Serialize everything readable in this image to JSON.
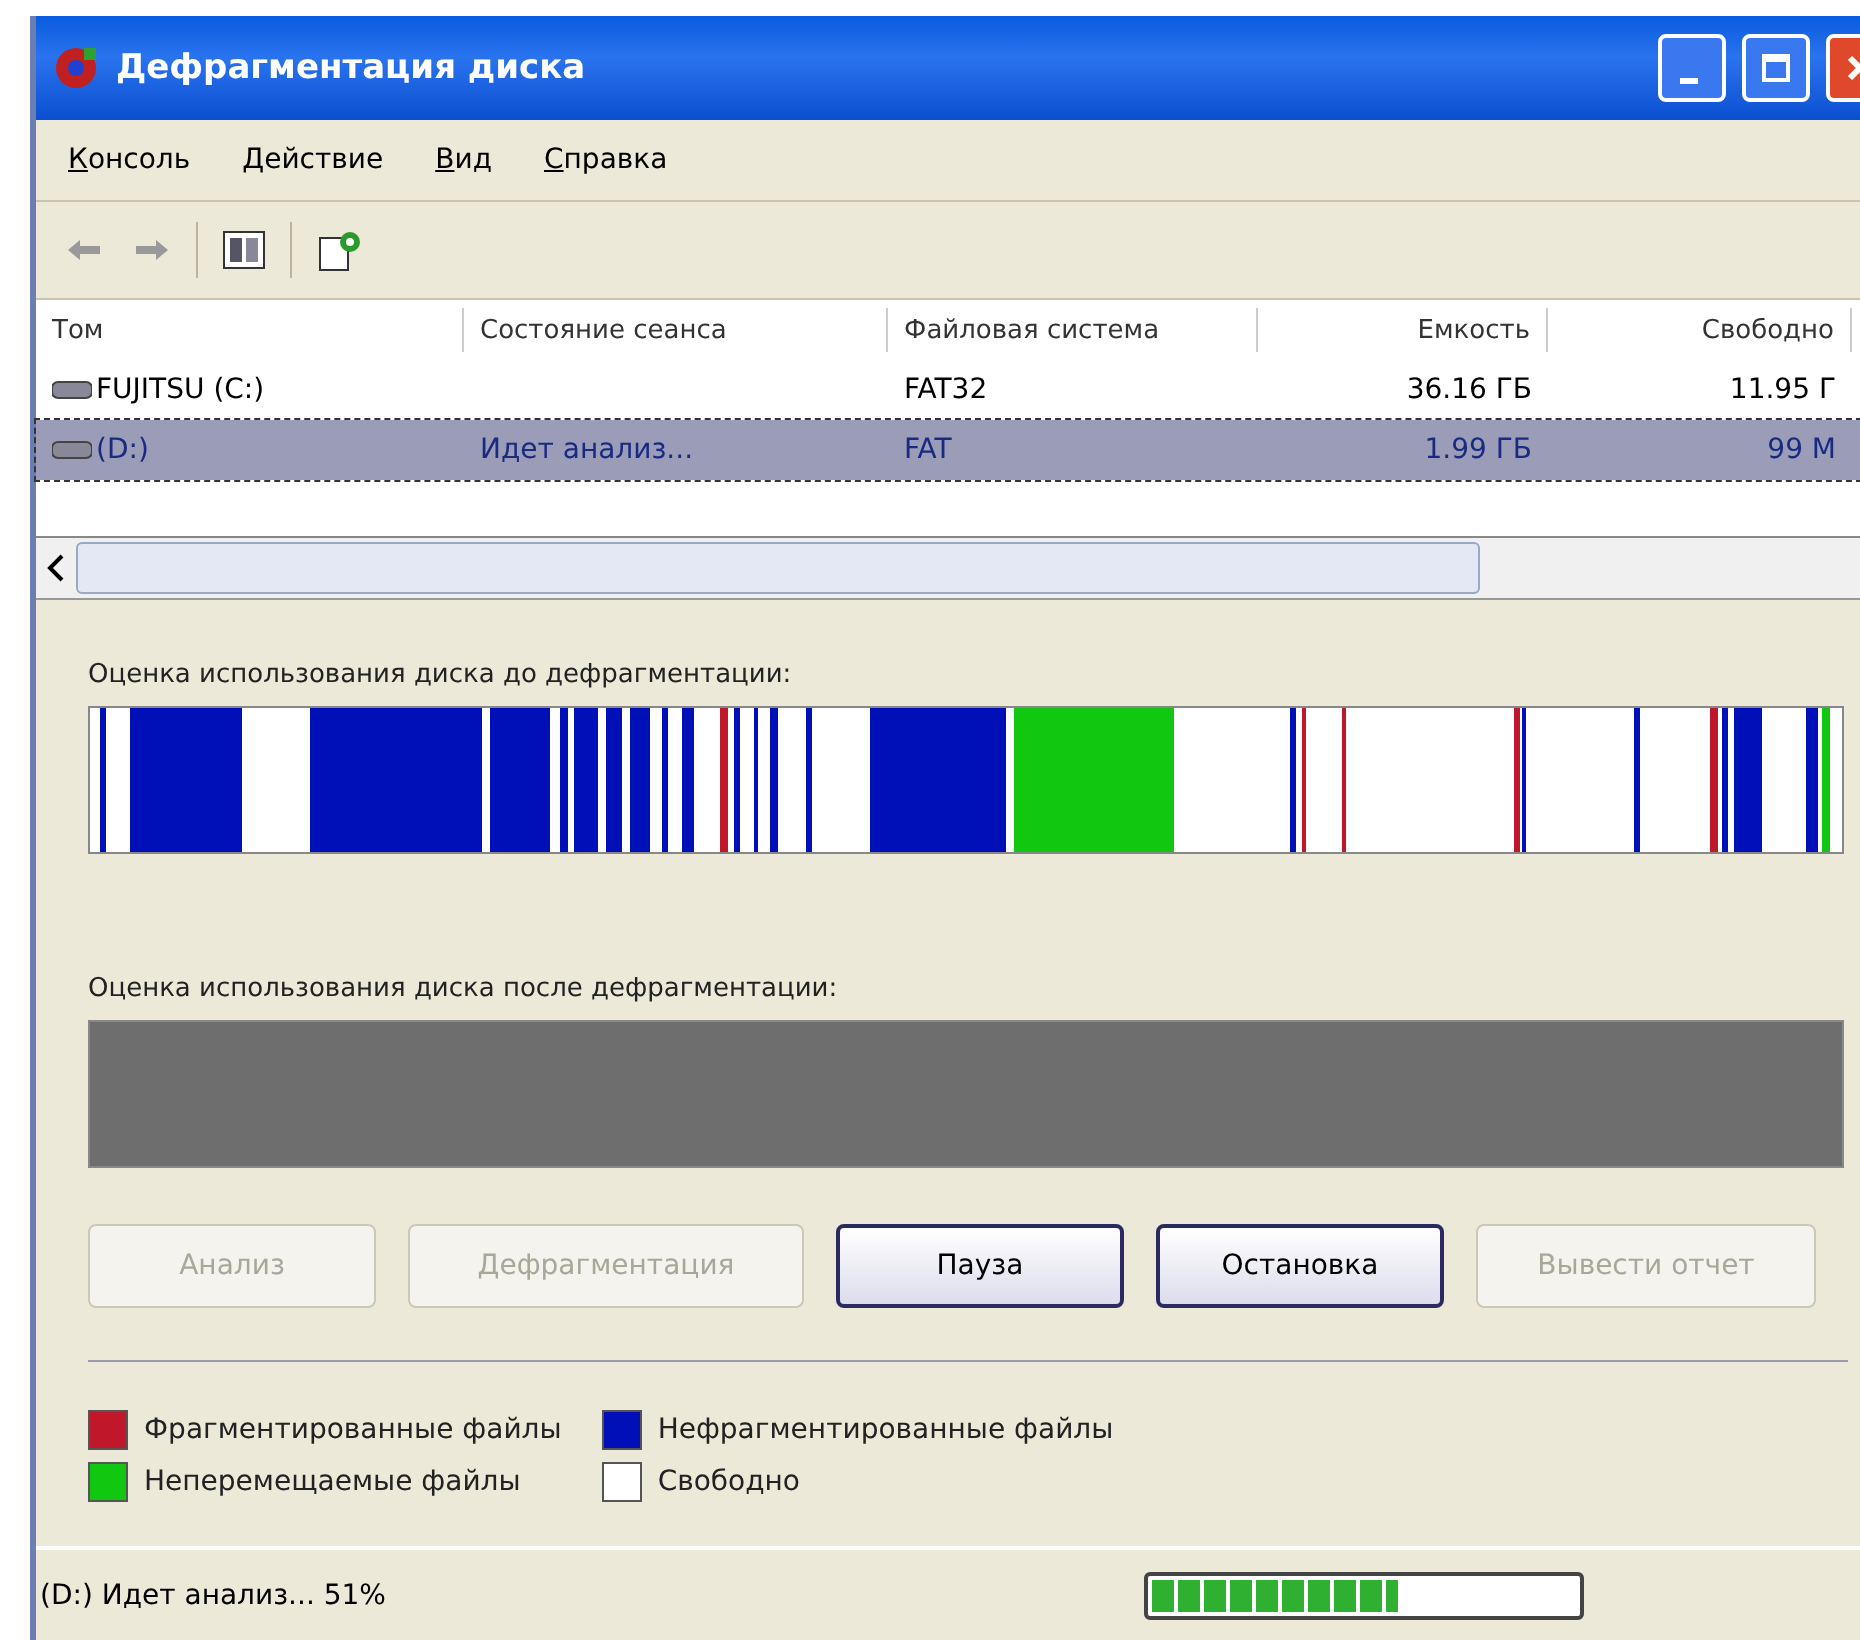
{
  "window": {
    "title": "Дефрагментация диска"
  },
  "menu": [
    {
      "label": "Консоль"
    },
    {
      "label": "Действие"
    },
    {
      "label": "Вид"
    },
    {
      "label": "Справка"
    }
  ],
  "volumes": {
    "columns": [
      {
        "label": "Том"
      },
      {
        "label": "Состояние сеанса"
      },
      {
        "label": "Файловая система"
      },
      {
        "label": "Емкость"
      },
      {
        "label": "Свободно"
      }
    ],
    "rows": [
      {
        "selected": false,
        "cells": [
          "FUJITSU (C:)",
          "",
          "FAT32",
          "36.16 ГБ",
          "11.95 Г"
        ]
      },
      {
        "selected": true,
        "cells": [
          "(D:)",
          "Идет анализ...",
          "FAT",
          "1.99 ГБ",
          "99 М"
        ]
      }
    ]
  },
  "before_label": "Оценка использования диска до дефрагментации:",
  "after_label": "Оценка использования диска после дефрагментации:",
  "buttons": [
    {
      "label": "Анализ",
      "disabled": true
    },
    {
      "label": "Дефрагментация",
      "disabled": true
    },
    {
      "label": "Пауза",
      "disabled": false
    },
    {
      "label": "Остановка",
      "disabled": false
    },
    {
      "label": "Вывести отчет",
      "disabled": true
    }
  ],
  "legend": [
    {
      "label": "Фрагментированные файлы",
      "color": "#c0182a"
    },
    {
      "label": "Нефрагментированные файлы",
      "color": "#0010b8"
    },
    {
      "label": "Неперемещаемые файлы",
      "color": "#10c810"
    },
    {
      "label": "Свободно",
      "color": "#ffffff"
    }
  ],
  "status_bar": {
    "text": "(D:) Идет анализ... 51%",
    "progress": {
      "level": 0.58
    }
  }
}
